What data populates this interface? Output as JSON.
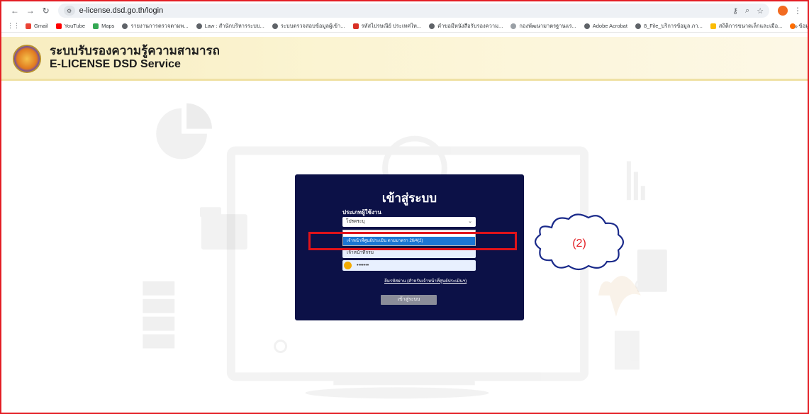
{
  "browser": {
    "url": "e-license.dsd.go.th/login",
    "bookmarks": [
      {
        "label": "Gmail",
        "color": "#ea4335"
      },
      {
        "label": "YouTube",
        "color": "#ff0000"
      },
      {
        "label": "Maps",
        "color": "#34a853"
      },
      {
        "label": "รายงานการตรวจตามพ...",
        "color": "#5f6368"
      },
      {
        "label": "Law : สำนักบริหารระบบ...",
        "color": "#5f6368"
      },
      {
        "label": "ระบบตรวจสอบข้อมูลผู้เข้า...",
        "color": "#5f6368"
      },
      {
        "label": "รหัสไปรษณีย์ ประเทศไท...",
        "color": "#d93025"
      },
      {
        "label": "คำขอมีหนังสือรับรองความ...",
        "color": "#5f6368"
      },
      {
        "label": "กองพัฒนามาตรฐานแร...",
        "color": "#9aa0a6"
      },
      {
        "label": "Adobe Acrobat",
        "color": "#5f6368"
      },
      {
        "label": "8_File_บริการข้อมูล ภา...",
        "color": "#5f6368"
      },
      {
        "label": "สถิติการขนาดเล็กและเมือ...",
        "color": "#fbbc04"
      },
      {
        "label": "ข้อมูลสำหรับผู้ประกอบ...",
        "color": "#ff6d00"
      }
    ],
    "more": "»"
  },
  "site": {
    "title_th": "ระบบรับรองความรู้ความสามารถ",
    "title_en": "E-LICENSE DSD Service"
  },
  "login": {
    "title": "เข้าสู่ระบบ",
    "user_type_label": "ประเภทผู้ใช้งาน",
    "select_value": "โปรดระบุ",
    "options": [
      "",
      "เจ้าหน้าที่ศูนย์ประเมิน ตามมาตรา 26/4(2)"
    ],
    "username_value": "เจ้าหน้าที่กรม",
    "password_value": "•••••••",
    "forgot_link": "ลืมรหัสผ่าน (สำหรับเจ้าหน้าที่ศูนย์ประเมินฯ)",
    "submit_label": "เข้าสู่ระบบ"
  },
  "annotation": {
    "label": "(2)",
    "color": "#e31e24"
  }
}
